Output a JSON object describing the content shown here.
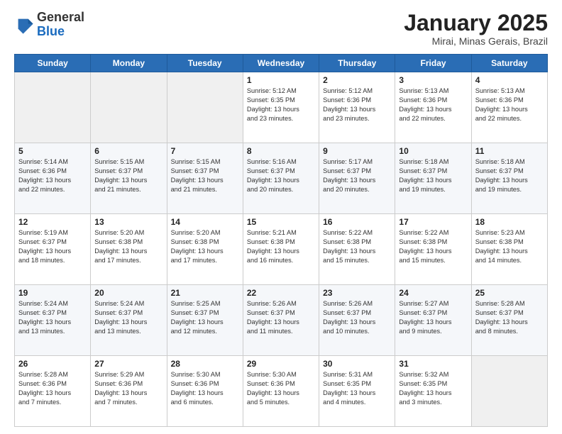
{
  "header": {
    "logo_general": "General",
    "logo_blue": "Blue",
    "month_title": "January 2025",
    "subtitle": "Mirai, Minas Gerais, Brazil"
  },
  "days_of_week": [
    "Sunday",
    "Monday",
    "Tuesday",
    "Wednesday",
    "Thursday",
    "Friday",
    "Saturday"
  ],
  "weeks": [
    [
      {
        "day": "",
        "info": ""
      },
      {
        "day": "",
        "info": ""
      },
      {
        "day": "",
        "info": ""
      },
      {
        "day": "1",
        "info": "Sunrise: 5:12 AM\nSunset: 6:35 PM\nDaylight: 13 hours\nand 23 minutes."
      },
      {
        "day": "2",
        "info": "Sunrise: 5:12 AM\nSunset: 6:36 PM\nDaylight: 13 hours\nand 23 minutes."
      },
      {
        "day": "3",
        "info": "Sunrise: 5:13 AM\nSunset: 6:36 PM\nDaylight: 13 hours\nand 22 minutes."
      },
      {
        "day": "4",
        "info": "Sunrise: 5:13 AM\nSunset: 6:36 PM\nDaylight: 13 hours\nand 22 minutes."
      }
    ],
    [
      {
        "day": "5",
        "info": "Sunrise: 5:14 AM\nSunset: 6:36 PM\nDaylight: 13 hours\nand 22 minutes."
      },
      {
        "day": "6",
        "info": "Sunrise: 5:15 AM\nSunset: 6:37 PM\nDaylight: 13 hours\nand 21 minutes."
      },
      {
        "day": "7",
        "info": "Sunrise: 5:15 AM\nSunset: 6:37 PM\nDaylight: 13 hours\nand 21 minutes."
      },
      {
        "day": "8",
        "info": "Sunrise: 5:16 AM\nSunset: 6:37 PM\nDaylight: 13 hours\nand 20 minutes."
      },
      {
        "day": "9",
        "info": "Sunrise: 5:17 AM\nSunset: 6:37 PM\nDaylight: 13 hours\nand 20 minutes."
      },
      {
        "day": "10",
        "info": "Sunrise: 5:18 AM\nSunset: 6:37 PM\nDaylight: 13 hours\nand 19 minutes."
      },
      {
        "day": "11",
        "info": "Sunrise: 5:18 AM\nSunset: 6:37 PM\nDaylight: 13 hours\nand 19 minutes."
      }
    ],
    [
      {
        "day": "12",
        "info": "Sunrise: 5:19 AM\nSunset: 6:37 PM\nDaylight: 13 hours\nand 18 minutes."
      },
      {
        "day": "13",
        "info": "Sunrise: 5:20 AM\nSunset: 6:38 PM\nDaylight: 13 hours\nand 17 minutes."
      },
      {
        "day": "14",
        "info": "Sunrise: 5:20 AM\nSunset: 6:38 PM\nDaylight: 13 hours\nand 17 minutes."
      },
      {
        "day": "15",
        "info": "Sunrise: 5:21 AM\nSunset: 6:38 PM\nDaylight: 13 hours\nand 16 minutes."
      },
      {
        "day": "16",
        "info": "Sunrise: 5:22 AM\nSunset: 6:38 PM\nDaylight: 13 hours\nand 15 minutes."
      },
      {
        "day": "17",
        "info": "Sunrise: 5:22 AM\nSunset: 6:38 PM\nDaylight: 13 hours\nand 15 minutes."
      },
      {
        "day": "18",
        "info": "Sunrise: 5:23 AM\nSunset: 6:38 PM\nDaylight: 13 hours\nand 14 minutes."
      }
    ],
    [
      {
        "day": "19",
        "info": "Sunrise: 5:24 AM\nSunset: 6:37 PM\nDaylight: 13 hours\nand 13 minutes."
      },
      {
        "day": "20",
        "info": "Sunrise: 5:24 AM\nSunset: 6:37 PM\nDaylight: 13 hours\nand 13 minutes."
      },
      {
        "day": "21",
        "info": "Sunrise: 5:25 AM\nSunset: 6:37 PM\nDaylight: 13 hours\nand 12 minutes."
      },
      {
        "day": "22",
        "info": "Sunrise: 5:26 AM\nSunset: 6:37 PM\nDaylight: 13 hours\nand 11 minutes."
      },
      {
        "day": "23",
        "info": "Sunrise: 5:26 AM\nSunset: 6:37 PM\nDaylight: 13 hours\nand 10 minutes."
      },
      {
        "day": "24",
        "info": "Sunrise: 5:27 AM\nSunset: 6:37 PM\nDaylight: 13 hours\nand 9 minutes."
      },
      {
        "day": "25",
        "info": "Sunrise: 5:28 AM\nSunset: 6:37 PM\nDaylight: 13 hours\nand 8 minutes."
      }
    ],
    [
      {
        "day": "26",
        "info": "Sunrise: 5:28 AM\nSunset: 6:36 PM\nDaylight: 13 hours\nand 7 minutes."
      },
      {
        "day": "27",
        "info": "Sunrise: 5:29 AM\nSunset: 6:36 PM\nDaylight: 13 hours\nand 7 minutes."
      },
      {
        "day": "28",
        "info": "Sunrise: 5:30 AM\nSunset: 6:36 PM\nDaylight: 13 hours\nand 6 minutes."
      },
      {
        "day": "29",
        "info": "Sunrise: 5:30 AM\nSunset: 6:36 PM\nDaylight: 13 hours\nand 5 minutes."
      },
      {
        "day": "30",
        "info": "Sunrise: 5:31 AM\nSunset: 6:35 PM\nDaylight: 13 hours\nand 4 minutes."
      },
      {
        "day": "31",
        "info": "Sunrise: 5:32 AM\nSunset: 6:35 PM\nDaylight: 13 hours\nand 3 minutes."
      },
      {
        "day": "",
        "info": ""
      }
    ]
  ]
}
